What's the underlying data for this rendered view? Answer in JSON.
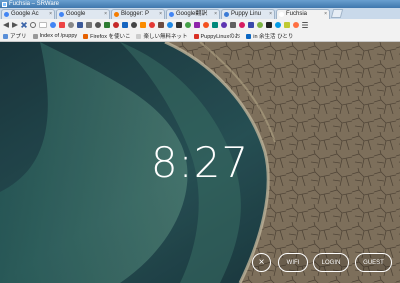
{
  "window": {
    "title": "Fuchsia – SRWare"
  },
  "tabs": [
    {
      "label": "Google Ac",
      "favicon_color": "#4285f4",
      "active": false
    },
    {
      "label": "Google",
      "favicon_color": "#4285f4",
      "active": false
    },
    {
      "label": "Blogger: P",
      "favicon_color": "#f57d00",
      "active": false
    },
    {
      "label": "Google翻訳",
      "favicon_color": "#4285f4",
      "active": false
    },
    {
      "label": "Puppy Linu",
      "favicon_color": "#3b7bd6",
      "active": false
    },
    {
      "label": "Fuchsia",
      "favicon_color": "#ffffff",
      "active": true
    }
  ],
  "toolbar": {
    "icons": [
      "back-icon",
      "forward-icon",
      "stop-icon",
      "info-icon",
      "extension-icon",
      "google-icon",
      "bookmark-icon",
      "facebook-icon"
    ]
  },
  "bookmarks": [
    {
      "label": "アプリ",
      "icon_color": "#5a8fd8"
    },
    {
      "label": "Index of /puppy",
      "icon_color": "#999999"
    },
    {
      "label": "Firefox を使いこ",
      "icon_color": "#e66000"
    },
    {
      "label": "楽しい無料ネット",
      "icon_color": "#cccccc"
    },
    {
      "label": "PuppyLinuxのお",
      "icon_color": "#d93025"
    },
    {
      "label": "in 余生活 ひとり",
      "icon_color": "#0a66c2"
    }
  ],
  "lockscreen": {
    "time": "8:27",
    "wifi_label": "WIFI",
    "login_label": "LOGIN",
    "guest_label": "GUEST",
    "close_symbol": "×"
  }
}
